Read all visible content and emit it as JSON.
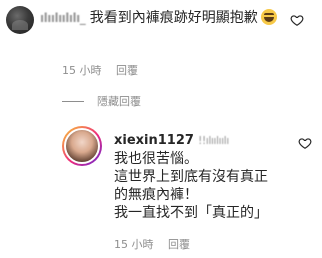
{
  "top_comment": {
    "username_blurred": "ılıılıılılı_",
    "text": "我看到內褲痕跡好明顯抱歉",
    "emoji": "grinning-sweat-face",
    "time": "15 小時",
    "reply_label": "回覆"
  },
  "hide_replies_label": "隱藏回覆",
  "reply": {
    "username": "xiexin1127",
    "mention_blurred": "!!ılıılıılı",
    "lines": [
      "我也很苦惱。",
      "這世界上到底有沒有真正",
      "的無痕內褲！",
      "我一直找不到「真正的」"
    ],
    "time": "15 小時",
    "reply_label": "回覆"
  },
  "colors": {
    "text": "#262626",
    "meta": "#8e8e8e",
    "background": "#ffffff"
  }
}
